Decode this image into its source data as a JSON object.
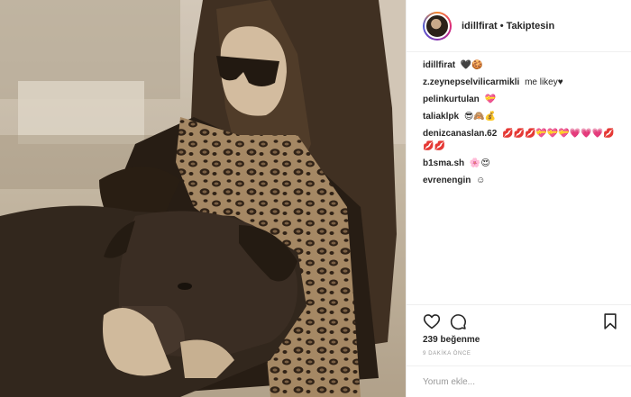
{
  "post": {
    "username": "idillfirat",
    "separator": "•",
    "follow_status": "Takiptesin"
  },
  "comments": [
    {
      "user": "idillfirat",
      "text": "🖤🍪"
    },
    {
      "user": "z.zeynepselvilicarmikli",
      "text": "me likey♥"
    },
    {
      "user": "pelinkurtulan",
      "text": "💝"
    },
    {
      "user": "taliaklpk",
      "text": "😎🙈💰"
    },
    {
      "user": "denizcanaslan.62",
      "text": "💋💋💋💝💝💝💗💗💗💋💋💋"
    },
    {
      "user": "b1sma.sh",
      "text": "🌸😍"
    },
    {
      "user": "evrenengin",
      "text": "☺"
    }
  ],
  "likes_text": "239 beğenme",
  "time_text": "9 DAKİKA ÖNCE",
  "add_comment_placeholder": "Yorum ekle...",
  "icons": {
    "like": "heart-icon",
    "comment": "comment-bubble-icon",
    "save": "bookmark-icon"
  },
  "colors": {
    "text": "#262626",
    "muted": "#999999",
    "border": "#efefef",
    "photo_sepia": "#cfc3b2"
  }
}
